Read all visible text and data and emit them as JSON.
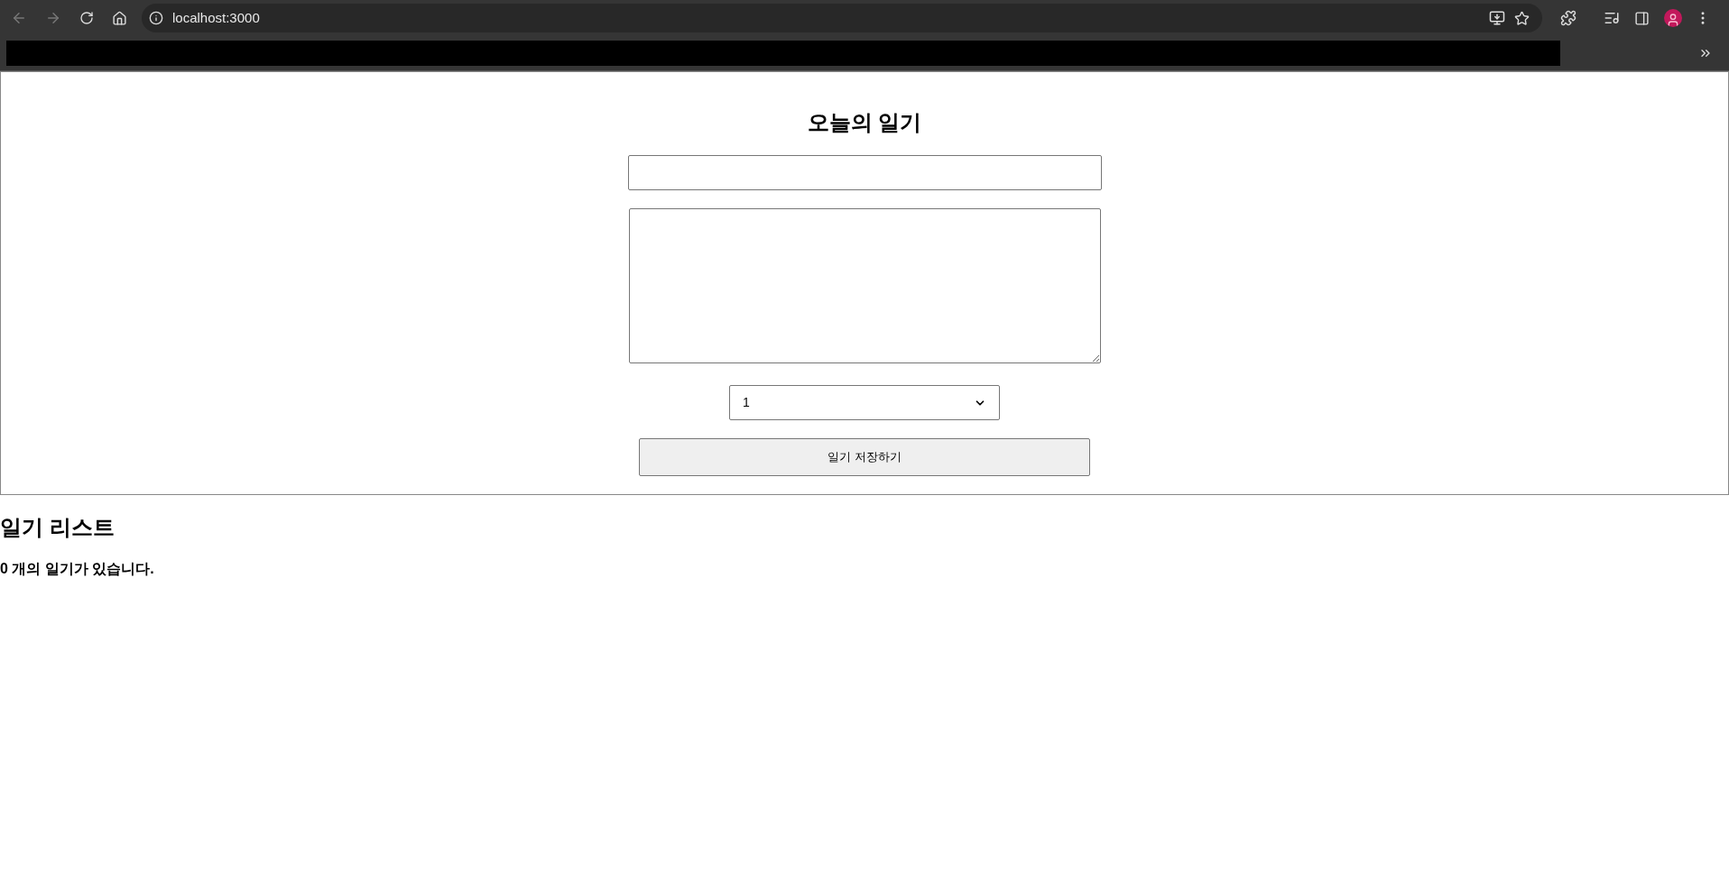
{
  "browser": {
    "url": "localhost:3000"
  },
  "editor": {
    "title": "오늘의 일기",
    "emotion_select": {
      "value": "1"
    },
    "save_button": "일기 저장하기"
  },
  "diary_list": {
    "heading": "일기 리스트",
    "count_text": "**0** 개의 일기가 있습니다."
  }
}
